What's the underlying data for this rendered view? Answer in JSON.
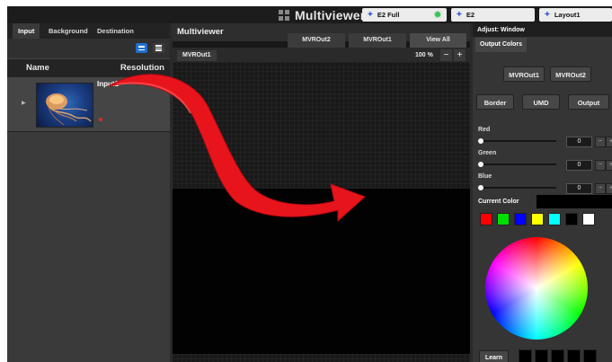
{
  "topbar": {
    "title": "Multiviewer",
    "tabs": [
      {
        "label": "E2 Full",
        "status": "active"
      },
      {
        "label": "E2"
      },
      {
        "label": "Layout1"
      }
    ]
  },
  "left_panel": {
    "tabs": [
      "Input",
      "Background",
      "Destination"
    ],
    "active_tab": "Input",
    "headers": {
      "name": "Name",
      "resolution": "Resolution"
    },
    "items": [
      {
        "name": "Input1",
        "thumbnail_icon": "jellyfish-image",
        "status_color": "#e02a2a"
      }
    ]
  },
  "center": {
    "title": "Multiviewer",
    "tabs": [
      "MVROut2",
      "MVROut1",
      "View All"
    ],
    "active_tab": "View All",
    "output_label": "MVROut1",
    "zoom": "100 %",
    "zoom_out": "−",
    "zoom_in": "+"
  },
  "right_panel": {
    "header": "Adjust: Window",
    "section": "Output Colors",
    "output_buttons": [
      "MVROut1",
      "MVROut2"
    ],
    "mode_buttons": [
      "Border",
      "UMD",
      "Output"
    ],
    "channels": [
      {
        "label": "Red",
        "value": "0"
      },
      {
        "label": "Green",
        "value": "0"
      },
      {
        "label": "Blue",
        "value": "0"
      }
    ],
    "current_color_label": "Current Color",
    "current_color": "#000000",
    "swatches": [
      "#ff0000",
      "#00e000",
      "#0000ff",
      "#ffff00",
      "#00ffff",
      "#000000",
      "#ffffff"
    ],
    "learn_label": "Learn"
  },
  "colors": {
    "arrow": "#e8141c",
    "accent_blue": "#1f6fd0"
  }
}
